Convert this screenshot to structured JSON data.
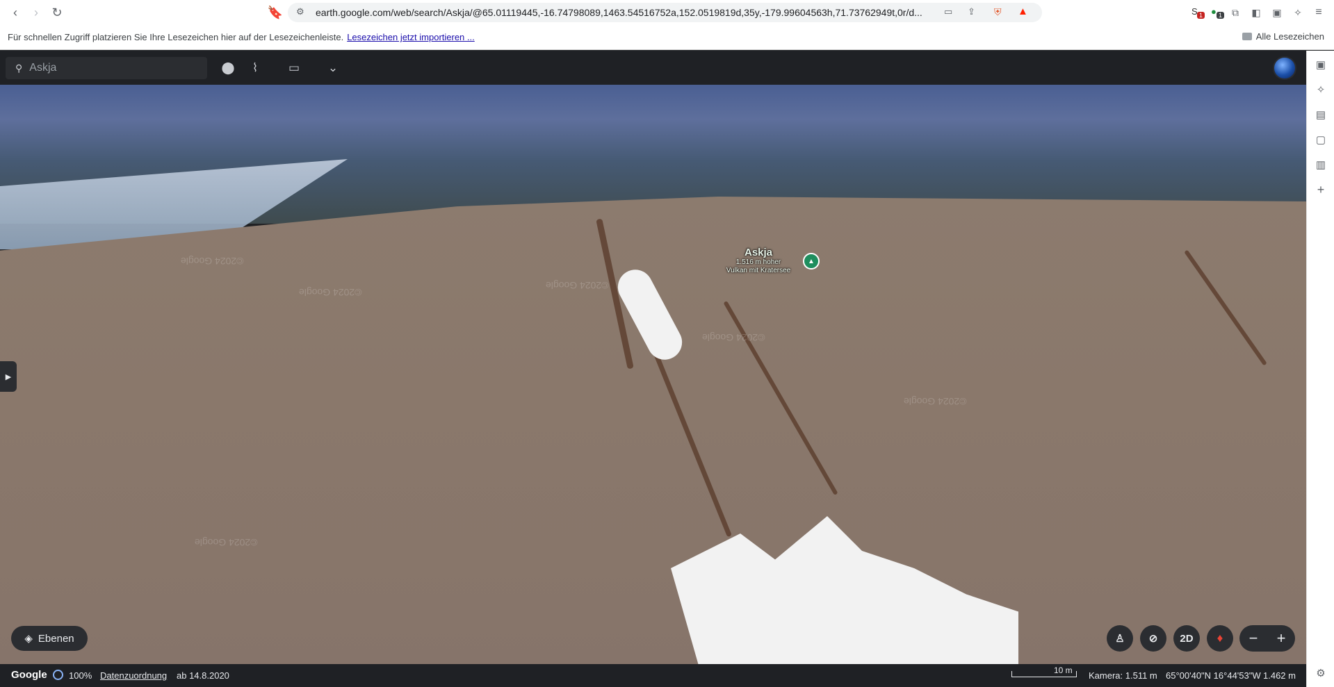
{
  "browser": {
    "url": "earth.google.com/web/search/Askja/@65.01119445,-16.74798089,1463.54516752a,152.0519819d,35y,-179.99604563h,71.73762949t,0r/d...",
    "bookmarks_hint": "Für schnellen Zugriff platzieren Sie Ihre Lesezeichen hier auf der Lesezeichenleiste.",
    "bookmarks_import_link": "Lesezeichen jetzt importieren ...",
    "all_bookmarks": "Alle Lesezeichen",
    "extension_badges": [
      "1",
      "1"
    ]
  },
  "earth": {
    "search": {
      "value": "Askja"
    },
    "place": {
      "title": "Askja",
      "subtitle_line1": "1.516 m hoher",
      "subtitle_line2": "Vulkan mit Kratersee"
    },
    "layers_label": "Ebenen",
    "view_mode_label": "2D",
    "status": {
      "logo": "Google",
      "load_percent": "100%",
      "attribution": "Datenzuordnung",
      "imagery_date": "ab 14.8.2020",
      "scale": "10 m",
      "camera": "Kamera: 1.511 m",
      "coordinates": "65°00'40\"N 16°44'53\"W",
      "elevation": "1.462 m"
    },
    "watermarks": [
      "©2024 Google",
      "©2024 Google",
      "©2024 Google",
      "©2024 Google",
      "©2024 Google",
      "©2024 Google"
    ]
  },
  "colors": {
    "accent": "#1e8e5e",
    "toolbar_dark": "#1f2125"
  }
}
